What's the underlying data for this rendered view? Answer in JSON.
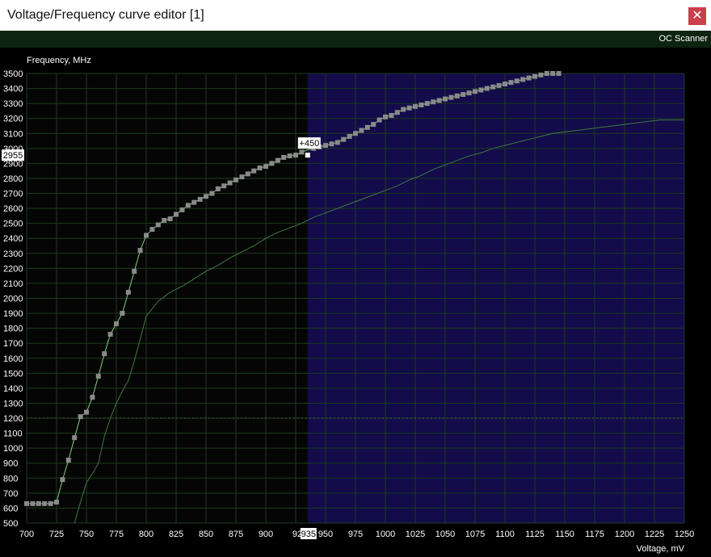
{
  "window": {
    "title": "Voltage/Frequency curve editor [1]",
    "close_glyph": "✕"
  },
  "toolbar": {
    "oc_scanner_label": "OC Scanner"
  },
  "chart_data": {
    "type": "line",
    "title": "",
    "xlabel": "Voltage, mV",
    "ylabel": "Frequency, MHz",
    "xlim": [
      700,
      1250
    ],
    "ylim": [
      500,
      3500
    ],
    "x_ticks": [
      700,
      725,
      750,
      775,
      800,
      825,
      850,
      875,
      900,
      925,
      950,
      975,
      1000,
      1025,
      1050,
      1075,
      1100,
      1125,
      1150,
      1175,
      1200,
      1225,
      1250
    ],
    "y_ticks": [
      500,
      600,
      700,
      800,
      900,
      1000,
      1100,
      1200,
      1300,
      1400,
      1500,
      1600,
      1700,
      1800,
      1900,
      2000,
      2100,
      2200,
      2300,
      2400,
      2500,
      2600,
      2700,
      2800,
      2900,
      3000,
      3100,
      3200,
      3300,
      3400,
      3500
    ],
    "reference_line_y": 1200,
    "locked_region_start_x": 935,
    "selected_point": {
      "x": 935,
      "y": 2955,
      "offset_label": "+450",
      "x_label": "935",
      "y_label": "2955"
    },
    "series": [
      {
        "role": "edited",
        "color": "#7fd17f",
        "x": [
          700,
          705,
          710,
          715,
          720,
          725,
          730,
          735,
          740,
          745,
          750,
          755,
          760,
          765,
          770,
          775,
          780,
          785,
          790,
          795,
          800,
          805,
          810,
          815,
          820,
          825,
          830,
          835,
          840,
          845,
          850,
          855,
          860,
          865,
          870,
          875,
          880,
          885,
          890,
          895,
          900,
          905,
          910,
          915,
          920,
          925,
          930,
          935,
          940,
          945,
          950,
          955,
          960,
          965,
          970,
          975,
          980,
          985,
          990,
          995,
          1000,
          1005,
          1010,
          1015,
          1020,
          1025,
          1030,
          1035,
          1040,
          1045,
          1050,
          1055,
          1060,
          1065,
          1070,
          1075,
          1080,
          1085,
          1090,
          1095,
          1100,
          1105,
          1110,
          1115,
          1120,
          1125,
          1130,
          1135,
          1140,
          1145
        ],
        "y": [
          630,
          630,
          630,
          630,
          630,
          640,
          790,
          920,
          1070,
          1210,
          1240,
          1340,
          1480,
          1630,
          1760,
          1830,
          1900,
          2040,
          2180,
          2320,
          2420,
          2460,
          2490,
          2520,
          2530,
          2560,
          2590,
          2620,
          2640,
          2660,
          2680,
          2700,
          2730,
          2750,
          2770,
          2790,
          2810,
          2830,
          2850,
          2870,
          2880,
          2900,
          2920,
          2940,
          2950,
          2955,
          2975,
          2990,
          3000,
          3010,
          3020,
          3030,
          3040,
          3060,
          3080,
          3100,
          3120,
          3140,
          3160,
          3190,
          3210,
          3220,
          3240,
          3260,
          3270,
          3280,
          3290,
          3300,
          3310,
          3320,
          3330,
          3340,
          3350,
          3360,
          3370,
          3380,
          3390,
          3400,
          3410,
          3420,
          3430,
          3440,
          3450,
          3460,
          3470,
          3480,
          3490,
          3500,
          3500,
          3500
        ]
      },
      {
        "role": "default",
        "color": "#3f7a3f",
        "x": [
          740,
          745,
          750,
          755,
          760,
          765,
          770,
          775,
          780,
          785,
          790,
          795,
          800,
          810,
          820,
          830,
          840,
          850,
          860,
          870,
          880,
          890,
          900,
          910,
          920,
          930,
          940,
          950,
          960,
          970,
          980,
          990,
          1000,
          1010,
          1020,
          1030,
          1040,
          1050,
          1060,
          1070,
          1080,
          1090,
          1100,
          1110,
          1120,
          1130,
          1140,
          1150,
          1160,
          1170,
          1180,
          1190,
          1200,
          1210,
          1220,
          1230,
          1240,
          1250
        ],
        "y": [
          500,
          640,
          770,
          830,
          900,
          1080,
          1200,
          1300,
          1380,
          1450,
          1580,
          1730,
          1880,
          1980,
          2040,
          2080,
          2130,
          2180,
          2220,
          2270,
          2310,
          2350,
          2400,
          2440,
          2470,
          2500,
          2540,
          2570,
          2600,
          2630,
          2660,
          2690,
          2720,
          2750,
          2790,
          2820,
          2860,
          2890,
          2920,
          2950,
          2970,
          3000,
          3020,
          3040,
          3060,
          3080,
          3100,
          3110,
          3120,
          3130,
          3140,
          3150,
          3160,
          3170,
          3180,
          3190,
          3190,
          3190
        ]
      }
    ]
  }
}
